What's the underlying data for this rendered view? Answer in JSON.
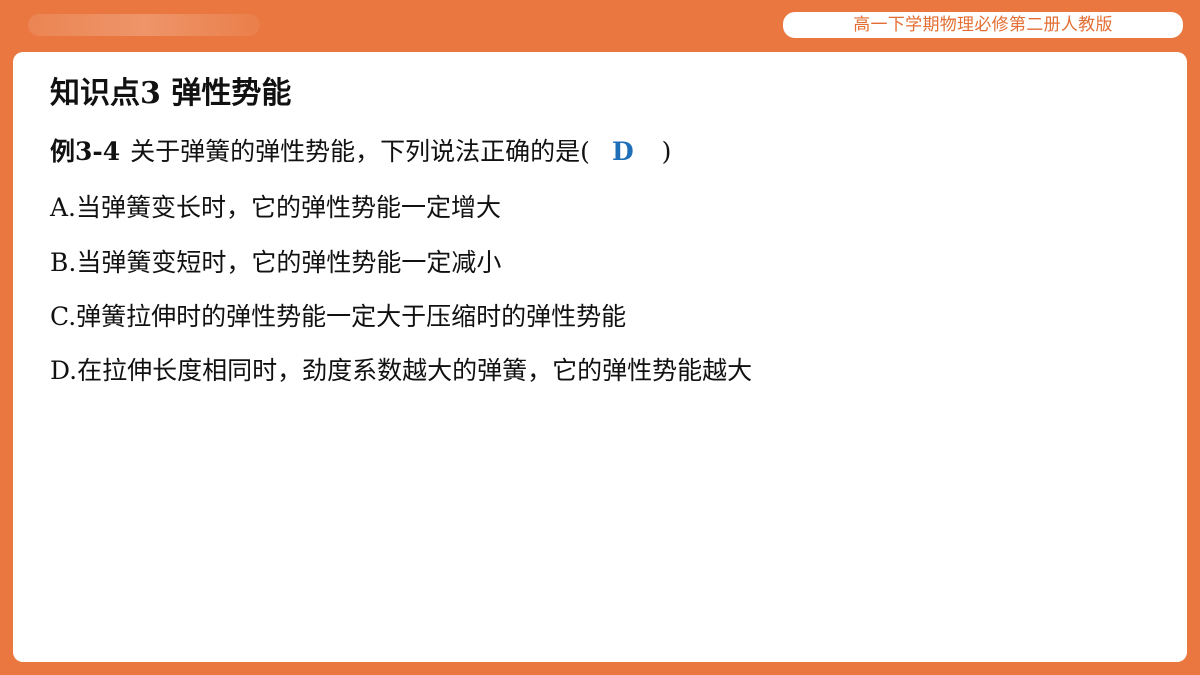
{
  "header": {
    "series_title": "高一下学期物理必修第二册人教版"
  },
  "slide": {
    "section_title": "知识点3  弹性势能",
    "question": {
      "label": "例3-4",
      "stem": "关于弹簧的弹性势能，下列说法正确的是(",
      "answer": "D",
      "close_paren": ")"
    },
    "options": [
      {
        "text": "A.当弹簧变长时，它的弹性势能一定增大"
      },
      {
        "text": "B.当弹簧变短时，它的弹性势能一定减小"
      },
      {
        "text": "C.弹簧拉伸时的弹性势能一定大于压缩时的弹性势能"
      },
      {
        "text": "D.在拉伸长度相同时，劲度系数越大的弹簧，它的弹性势能越大"
      }
    ]
  },
  "colors": {
    "frame": "#E9773F",
    "series_text": "#E36E33",
    "answer": "#1F6FB8"
  }
}
